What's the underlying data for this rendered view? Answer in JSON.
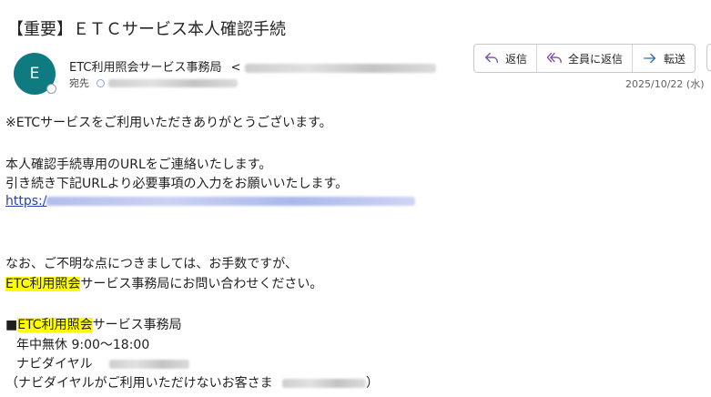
{
  "email": {
    "subject": "【重要】ＥＴＣサービス本人確認手続",
    "avatar_initial": "E",
    "sender_name": "ETC利用照会サービス事務局",
    "sender_email_open": "<",
    "to_label": "宛先",
    "date": "2025/10/22 (水)"
  },
  "actions": {
    "reply": "返信",
    "reply_all": "全員に返信",
    "forward": "転送"
  },
  "body": {
    "line1": "※ETCサービスをご利用いただきありがとうございます。",
    "line2": "本人確認手続専用のURLをご連絡いたします。",
    "line3": "引き続き下記URLより必要事項の入力をお願いいたします。",
    "link_prefix": "https:/",
    "line4": "なお、ご不明な点につきましては、お手数ですが、",
    "line5_hl": "ETC利用照会",
    "line5_rest": "サービス事務局にお問い合わせください。",
    "sig_bullet": "■",
    "sig_hl": "ETC利用照会",
    "sig_rest": "サービス事務局",
    "sig_hours": "年中無休  9:00〜18:00",
    "sig_navi": "ナビダイヤル",
    "sig_note_open": "（ナビダイヤルがご利用いただけないお客さま",
    "sig_note_close": "）"
  },
  "colors": {
    "avatar": "#0f7b80",
    "highlight": "#ffff00",
    "link": "#2a3ea8",
    "reply_icon": "#7a4fa3",
    "forward_icon": "#2f6fb3"
  },
  "icons": {
    "reply": "reply-arrow-icon",
    "reply_all": "reply-all-icon",
    "forward": "forward-arrow-icon"
  }
}
